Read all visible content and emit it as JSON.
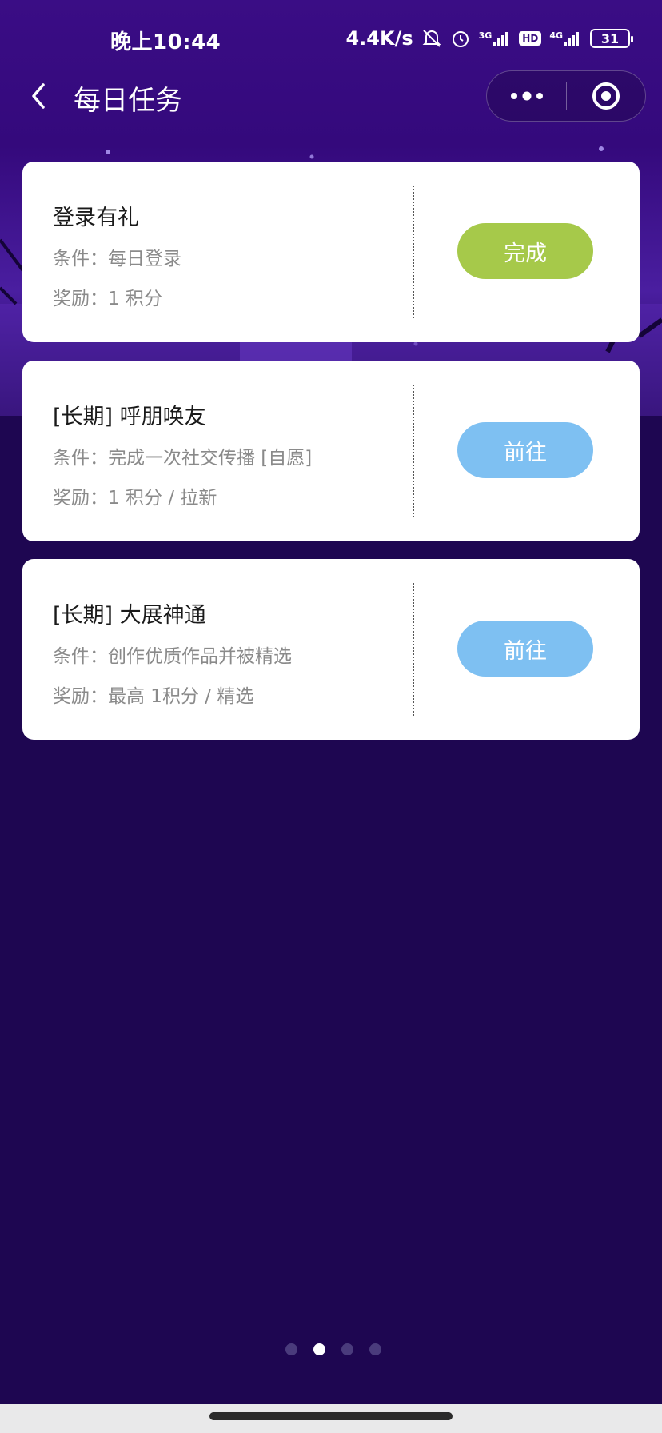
{
  "status": {
    "time": "晚上10:44",
    "speed": "4.4K/s",
    "network_3g": "3G",
    "hd": "HD",
    "network_4g": "4G",
    "battery": "31"
  },
  "nav": {
    "title": "每日任务"
  },
  "tasks": [
    {
      "title": "登录有礼",
      "condition": "条件：每日登录",
      "reward": "奖励：1 积分",
      "button": "完成",
      "button_color": "#a6c94a"
    },
    {
      "title": "[长期] 呼朋唤友",
      "condition": "条件：完成一次社交传播 [自愿]",
      "reward": "奖励：1 积分 / 拉新",
      "button": "前往",
      "button_color": "#7ec0f2"
    },
    {
      "title": "[长期] 大展神通",
      "condition": "条件：创作优质作品并被精选",
      "reward": "奖励：最高 1积分 / 精选",
      "button": "前往",
      "button_color": "#7ec0f2"
    }
  ],
  "pager": {
    "count": 4,
    "active_index": 1
  },
  "colors": {
    "background": "#1e0651",
    "header_purple": "#3a0d85",
    "done_green": "#a6c94a",
    "go_blue": "#7ec0f2"
  }
}
